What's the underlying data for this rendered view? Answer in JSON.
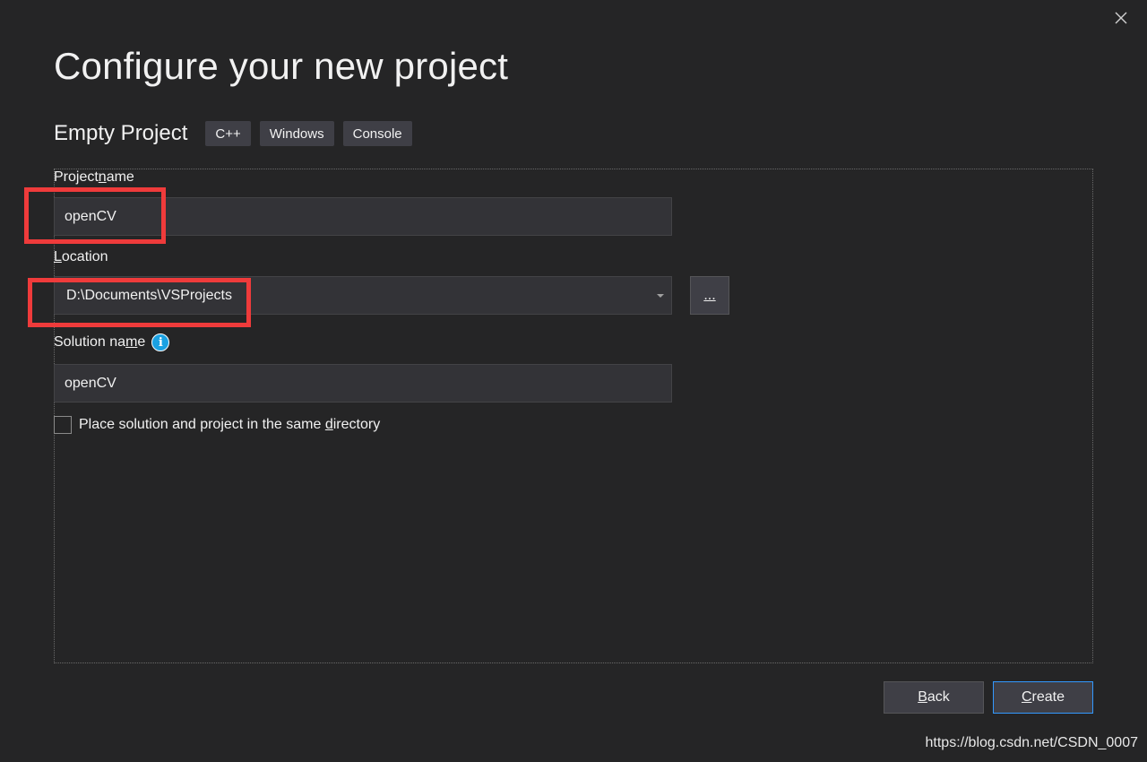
{
  "dialog": {
    "title": "Configure your new project",
    "close_icon": "close-icon"
  },
  "template": {
    "name": "Empty Project",
    "tags": [
      "C++",
      "Windows",
      "Console"
    ]
  },
  "project_name": {
    "label_pre": "Project ",
    "label_mnemonic": "n",
    "label_post": "ame",
    "value": "openCV"
  },
  "location": {
    "label_pre": "",
    "label_mnemonic": "L",
    "label_post": "ocation",
    "value": "D:\\Documents\\VSProjects",
    "browse_label": "..."
  },
  "solution_name": {
    "label_pre": "Solution na",
    "label_mnemonic": "m",
    "label_post": "e",
    "value": "openCV",
    "info_icon": "info-icon"
  },
  "same_directory": {
    "label_pre": "Place solution and project in the same ",
    "label_mnemonic": "d",
    "label_post": "irectory",
    "checked": false
  },
  "buttons": {
    "back_mnemonic": "B",
    "back_rest": "ack",
    "create_mnemonic": "C",
    "create_rest": "reate"
  },
  "watermark": "https://blog.csdn.net/CSDN_0007",
  "colors": {
    "background": "#252526",
    "field": "#333337",
    "highlight": "#ef3b3b",
    "accent": "#3399ff",
    "info": "#1ba1e2"
  }
}
